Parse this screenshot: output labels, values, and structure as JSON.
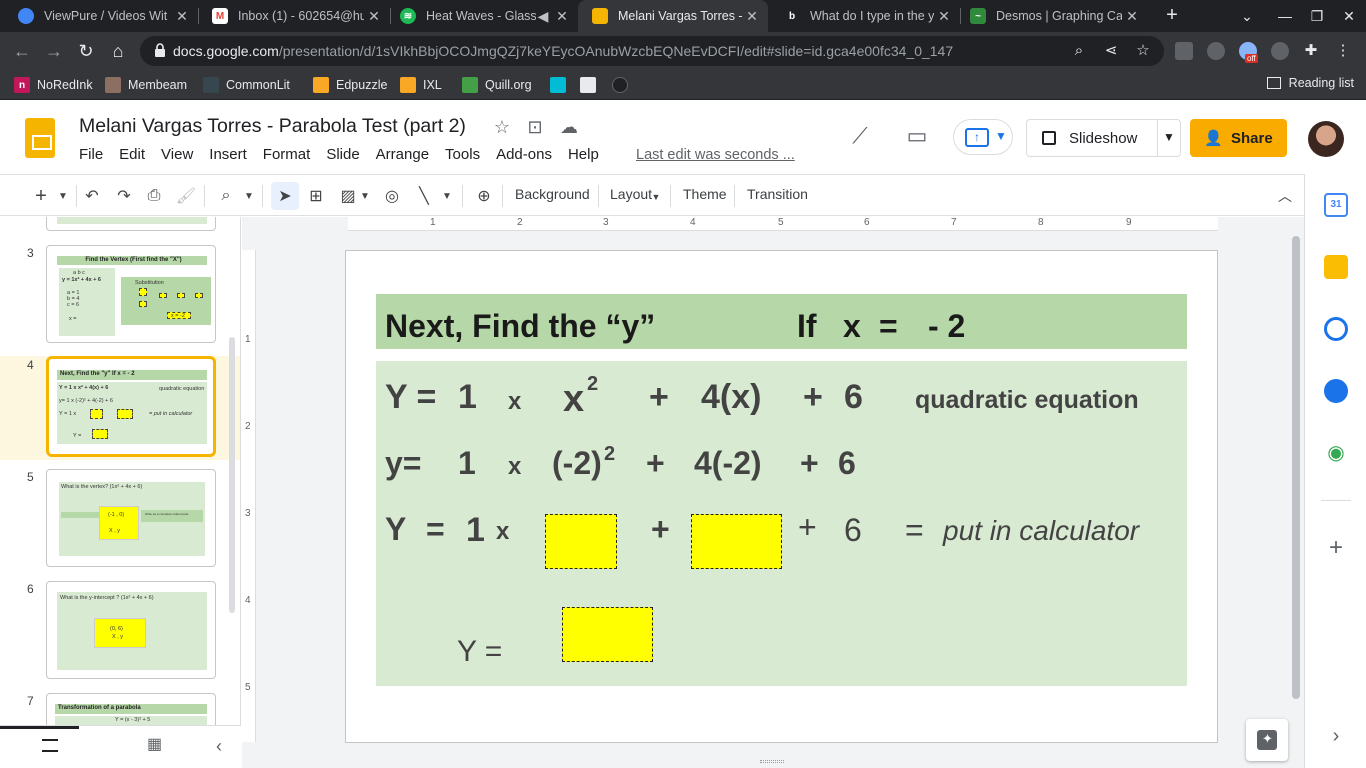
{
  "browser": {
    "tabs": [
      {
        "title": "ViewPure / Videos Wit",
        "icon": "viewpure-icon",
        "color": "#4285f4"
      },
      {
        "title": "Inbox (1) - 602654@hu",
        "icon": "gmail-icon",
        "color": "#ea4335"
      },
      {
        "title": "Heat Waves - Glass",
        "icon": "spotify-icon",
        "color": "#1db954"
      },
      {
        "title": "Melani Vargas Torres -",
        "icon": "slides-icon",
        "color": "#f4b400"
      },
      {
        "title": "What do I type in the ye",
        "icon": "bing-icon",
        "color": "#202124"
      },
      {
        "title": "Desmos | Graphing Cal",
        "icon": "desmos-icon",
        "color": "#2f8a3b"
      }
    ],
    "url_host": "docs.google.com",
    "url_path": "/presentation/d/1sVIkhBbjOCOJmgQZj7keYEycOAnubWzcbEQNeEvDCFI/edit#slide=id.gca4e00fc34_0_147",
    "extension_badge": "off",
    "bookmarks": [
      {
        "label": "NoRedInk",
        "color": "#c2185b"
      },
      {
        "label": "Membeam",
        "color": "#8d6e63"
      },
      {
        "label": "CommonLit",
        "color": "#37474f"
      },
      {
        "label": "Edpuzzle",
        "color": "#f9a825"
      },
      {
        "label": "IXL",
        "color": "#f9a825"
      },
      {
        "label": "Quill.org",
        "color": "#43a047"
      }
    ],
    "reading_list": "Reading list"
  },
  "doc": {
    "title": "Melani Vargas Torres - Parabola Test (part 2)",
    "menu": [
      "File",
      "Edit",
      "View",
      "Insert",
      "Format",
      "Slide",
      "Arrange",
      "Tools",
      "Add-ons",
      "Help"
    ],
    "last_edit": "Last edit was seconds ...",
    "slideshow_label": "Slideshow",
    "share_label": "Share"
  },
  "toolbar": {
    "background": "Background",
    "layout": "Layout",
    "theme": "Theme",
    "transition": "Transition"
  },
  "filmstrip": {
    "slides": [
      {
        "num": "3",
        "title": "Find the Vertex (First find the \"X\")"
      },
      {
        "num": "4",
        "title": "Next, Find the \"y\"          If  x  =  - 2",
        "selected": true
      },
      {
        "num": "5",
        "title": "What is the vertex?  (1x² + 4x + 6)"
      },
      {
        "num": "6",
        "title": "What is the y-intercept ?  (1x² + 4x + 6)"
      },
      {
        "num": "7",
        "title": "Transformation of a parabola"
      }
    ],
    "thumb3": {
      "abc": "a   b   c",
      "eq": "y = 1x² + 4x + 6",
      "a": "a = 1",
      "b": "b = 4",
      "c": "c = 6",
      "x": "x =",
      "sub": "Substitution",
      "xeq": "x = -2"
    },
    "thumb4": {
      "row1": "Y = 1  x   x²   + 4(x)   + 6",
      "row1b": "quadratic  equation",
      "row2": "y=   1   x  (-2)²   + 4(-2)   + 6",
      "row3": "Y = 1 x",
      "row3b": "= put in calculator",
      "row4": "Y ="
    },
    "thumb5": {
      "point": "(-1 , 0)",
      "xy": "X  ,  y",
      "note": "Write as a complete ordered pair"
    },
    "thumb6": {
      "point": "(0, 6)",
      "xy": "X , y"
    },
    "thumb7": {
      "sub": "Y = (x - 3)² + 5"
    }
  },
  "ruler": {
    "h": [
      "1",
      "2",
      "3",
      "4",
      "5",
      "6",
      "7",
      "8",
      "9"
    ],
    "v": [
      "1",
      "2",
      "3",
      "4",
      "5"
    ]
  },
  "slide": {
    "title_left": "Next, Find the “y”",
    "title_if": "If",
    "title_x": "x",
    "title_eq": "=",
    "title_val": "- 2",
    "row1": {
      "Y": "Y =",
      "one": "1",
      "times": "x",
      "x": "x",
      "exp": "2",
      "plus1": "+",
      "term": "4(x)",
      "plus2": "+",
      "c": "6",
      "label": "quadratic  equation"
    },
    "row2": {
      "y": "y=",
      "one": "1",
      "times": "x",
      "val": "(-2)",
      "exp": "2",
      "plus1": "+",
      "term": "4(-2)",
      "plus2": "+",
      "c": "6"
    },
    "row3": {
      "Y": "Y",
      "eq": "=",
      "one": "1",
      "times": "x",
      "plus1": "+",
      "plus2": "+",
      "c": "6",
      "eq2": "=",
      "note": "put in calculator"
    },
    "row4": {
      "label": "Y ="
    }
  },
  "colors": {
    "title_bar": "#b6d7a8",
    "body": "#d9ead3",
    "answer_box": "#ffff00",
    "accent": "#f4b400"
  }
}
